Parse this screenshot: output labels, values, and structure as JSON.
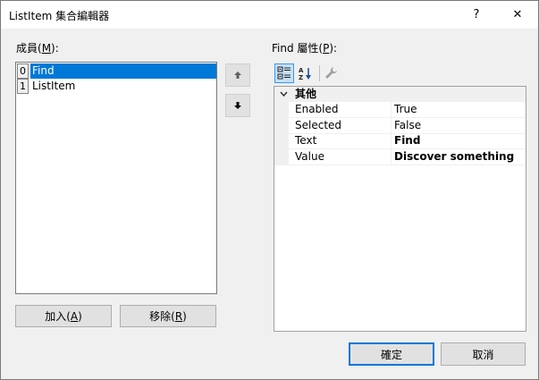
{
  "window": {
    "title": "ListItem 集合編輯器",
    "help_label": "?",
    "close_label": "✕"
  },
  "members": {
    "label_prefix": "成員(",
    "label_mnemonic": "M",
    "label_suffix": "):",
    "items": [
      {
        "index": "0",
        "text": "Find",
        "selected": true
      },
      {
        "index": "1",
        "text": "ListItem",
        "selected": false
      }
    ],
    "add_label_prefix": "加入(",
    "add_label_mnemonic": "A",
    "add_label_suffix": ")",
    "remove_label_prefix": "移除(",
    "remove_label_mnemonic": "R",
    "remove_label_suffix": ")"
  },
  "move": {
    "up_icon": "arrow-up-icon",
    "down_icon": "arrow-down-icon"
  },
  "properties": {
    "label_prefix": "Find 屬性(",
    "label_mnemonic": "P",
    "label_suffix": "):",
    "toolbar": {
      "categorized_icon": "categorized-icon",
      "alphabetical_icon": "alphabetical-icon",
      "property_pages_icon": "wrench-icon"
    },
    "category": "其他",
    "rows": [
      {
        "name": "Enabled",
        "value": "True",
        "bold": false
      },
      {
        "name": "Selected",
        "value": "False",
        "bold": false
      },
      {
        "name": "Text",
        "value": "Find",
        "bold": true
      },
      {
        "name": "Value",
        "value": "Discover something",
        "bold": true
      }
    ]
  },
  "footer": {
    "ok_label": "確定",
    "cancel_label": "取消"
  },
  "colors": {
    "selection": "#0078d7",
    "button_face": "#e1e1e1",
    "dialog_bg": "#f0f0f0"
  }
}
